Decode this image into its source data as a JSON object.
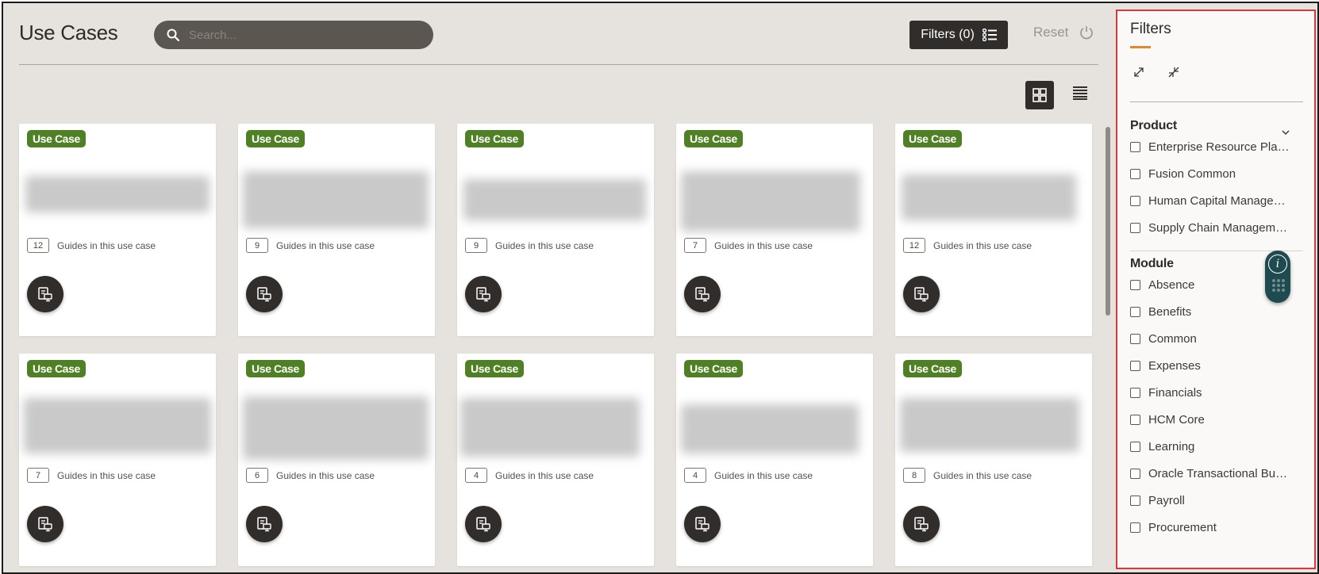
{
  "header": {
    "title": "Use Cases",
    "search_placeholder": "Search...",
    "filters_label": "Filters (0)",
    "reset_label": "Reset"
  },
  "card_badge": "Use Case",
  "card_guides_text": "Guides in this use case",
  "cards": [
    {
      "count": "12"
    },
    {
      "count": "9"
    },
    {
      "count": "9"
    },
    {
      "count": "7"
    },
    {
      "count": "12"
    },
    {
      "count": "7"
    },
    {
      "count": "6"
    },
    {
      "count": "4"
    },
    {
      "count": "4"
    },
    {
      "count": "8"
    }
  ],
  "filters_panel": {
    "title": "Filters",
    "groups": [
      {
        "title": "Product",
        "items": [
          "Enterprise Resource Plan...",
          "Fusion Common",
          "Human Capital Managem...",
          "Supply Chain Management"
        ]
      },
      {
        "title": "Module",
        "items": [
          "Absence",
          "Benefits",
          "Common",
          "Expenses",
          "Financials",
          "HCM Core",
          "Learning",
          "Oracle Transactional Busi...",
          "Payroll",
          "Procurement"
        ]
      }
    ]
  },
  "colors": {
    "badge": "#508025",
    "dark": "#312d2a",
    "panel_border": "#d8373d",
    "accent_underline": "#e08a2d",
    "help_widget": "#1f4a50"
  }
}
